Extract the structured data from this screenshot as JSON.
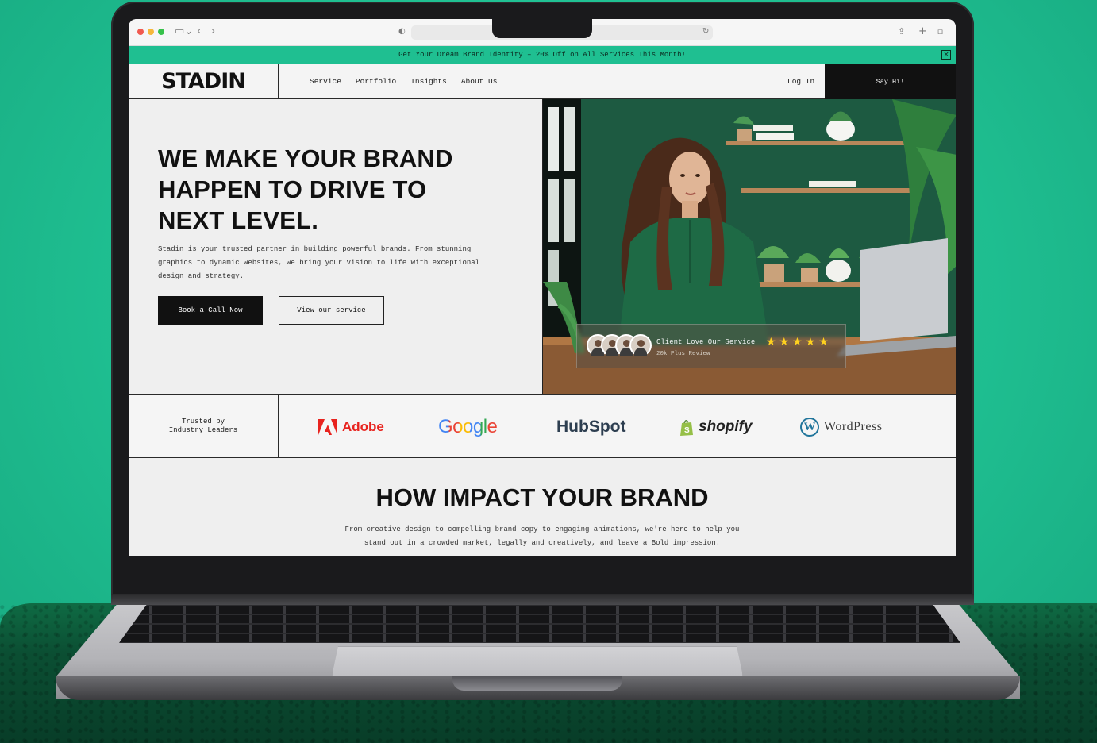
{
  "browser": {
    "url": ""
  },
  "promo": {
    "text": "Get Your Dream Brand Identity – 20% Off on All Services This Month!",
    "close_icon": "close-icon"
  },
  "nav": {
    "logo": "STADIN",
    "links": [
      "Service",
      "Portfolio",
      "Insights",
      "About Us"
    ],
    "login": "Log In",
    "cta": "Say Hi!"
  },
  "hero": {
    "title": "WE MAKE YOUR BRAND HAPPEN TO DRIVE TO NEXT LEVEL.",
    "description": "Stadin is your trusted partner in building powerful brands. From stunning graphics to dynamic websites, we bring your vision to life with exceptional design and strategy.",
    "primary_button": "Book a Call Now",
    "secondary_button": "View our service",
    "review": {
      "title": "Client Love Our Service",
      "subtitle": "20k Plus Review",
      "rating": 5,
      "stars": "★★★★★"
    }
  },
  "trusted": {
    "label": "Trusted by Industry Leaders",
    "brands": [
      "Adobe",
      "Google",
      "HubSpot",
      "shopify",
      "WordPress"
    ]
  },
  "impact": {
    "title": "HOW IMPACT YOUR BRAND",
    "description": "From creative design to compelling brand copy to engaging animations, we're here to help you stand out in a crowded market, legally and creatively, and leave a Bold impression."
  },
  "colors": {
    "accent": "#1fbf91",
    "dark": "#111111",
    "star": "#ffd21f",
    "adobe": "#e8231e",
    "wordpress": "#21759b"
  }
}
